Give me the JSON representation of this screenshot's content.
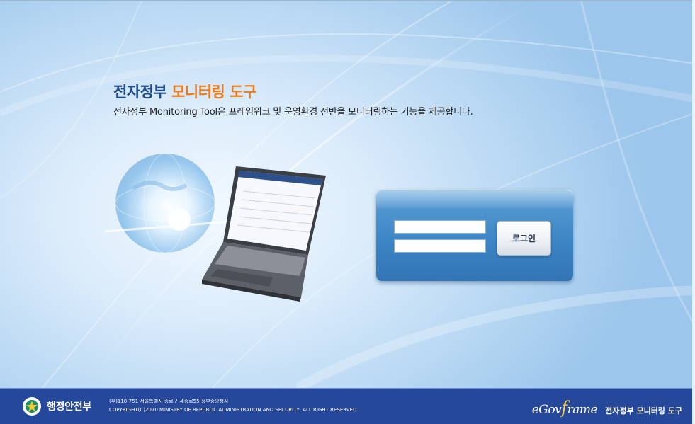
{
  "header": {
    "title_part1": "전자정부",
    "title_part2": "모니터링 도구",
    "subtitle": "전자정부 Monitoring Tool은 프레임워크 및 운영환경 전반을 모니터링하는 기능을 제공합니다."
  },
  "login": {
    "id_value": "",
    "password_value": "",
    "button_label": "로그인"
  },
  "footer": {
    "org_name": "행정안전부",
    "address": "(우)110-751 서울특별시 종로구 세종로55 정부중앙청사",
    "copyright": "COPYRIGHT(C)2010 MINISTRY OF REPUBLIC ADMINISTRATION AND SECURITY, ALL RIGHT RESERVED",
    "brand_logo_pre": "eGov",
    "brand_logo_f": "f",
    "brand_logo_post": "rame",
    "brand_name": "전자정부 모니터링 도구"
  },
  "colors": {
    "title_blue": "#1f4c8f",
    "title_orange": "#ef7b18",
    "footer_bg": "#26489a",
    "login_panel": "#3b83c3"
  }
}
